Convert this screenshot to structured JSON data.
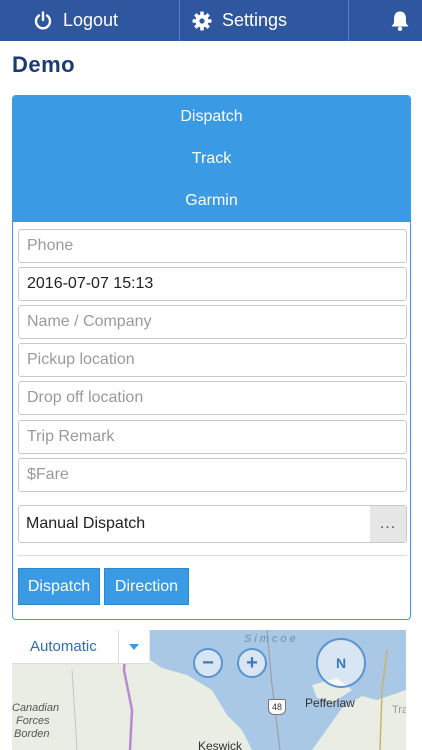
{
  "topbar": {
    "logout_label": "Logout",
    "settings_label": "Settings",
    "logout_icon": "power-icon",
    "settings_icon": "gear-icon",
    "notifications_icon": "bell-icon"
  },
  "page": {
    "title": "Demo"
  },
  "panel": {
    "links": [
      "Dispatch",
      "Track",
      "Garmin"
    ],
    "fields": {
      "phone_placeholder": "Phone",
      "datetime_value": "2016-07-07 15:13",
      "name_placeholder": "Name / Company",
      "pickup_placeholder": "Pickup location",
      "dropoff_placeholder": "Drop off location",
      "remark_placeholder": "Trip Remark",
      "fare_placeholder": "$Fare"
    },
    "dispatch_mode": {
      "value": "Manual Dispatch",
      "more": "..."
    },
    "buttons": {
      "dispatch": "Dispatch",
      "direction": "Direction"
    }
  },
  "map": {
    "mode_value": "Automatic",
    "labels": {
      "lake": "Simcoe",
      "town1": "Pefferlaw",
      "town2": "Keswick",
      "forces_line1": "Canadian",
      "forces_line2": "Forces",
      "forces_line3": "Borden",
      "edge": "Tra",
      "highway": "48"
    },
    "controls": {
      "zoom_out": "−",
      "zoom_in": "+",
      "compass": "N"
    }
  },
  "colors": {
    "topbar": "#2e57a0",
    "accent": "#3a9ae3",
    "title": "#1c3a73"
  }
}
